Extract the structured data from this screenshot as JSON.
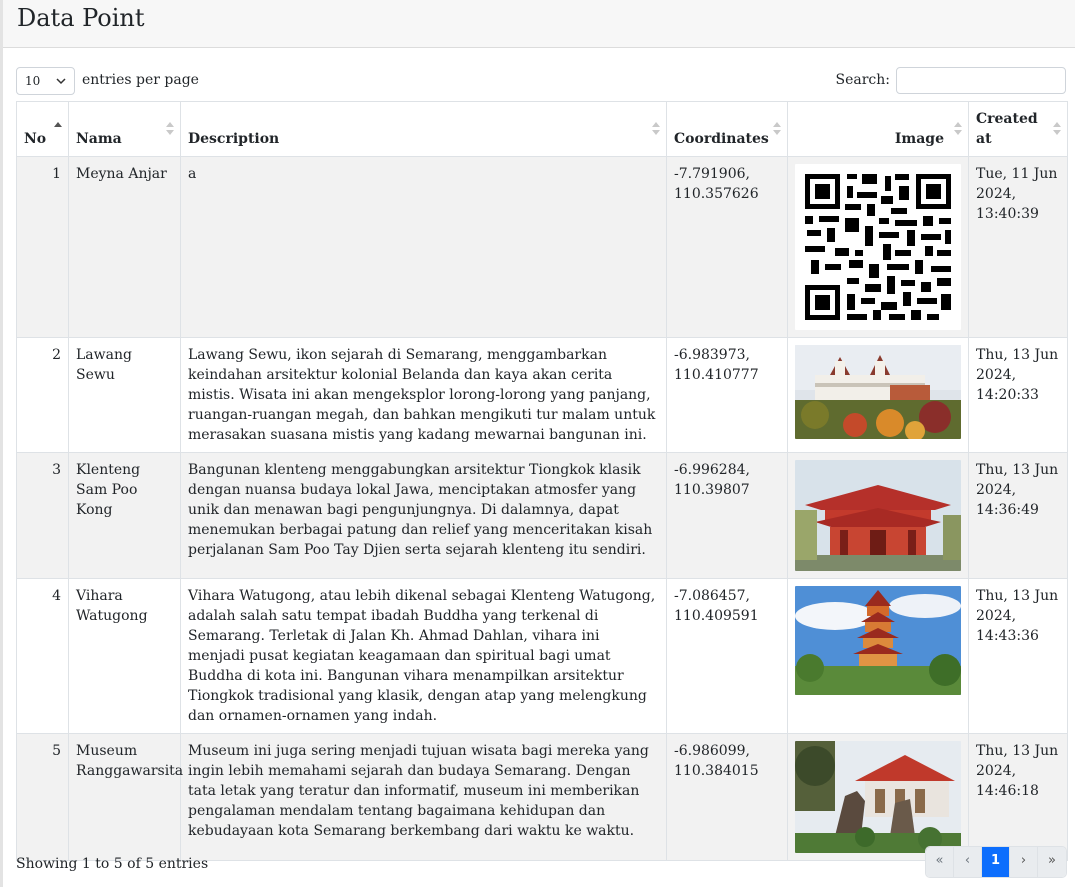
{
  "page": {
    "title": "Data Point"
  },
  "controls": {
    "length_value": "10",
    "length_label": "entries per page",
    "search_label": "Search:",
    "search_value": ""
  },
  "table": {
    "headers": [
      "No",
      "Nama",
      "Description",
      "Coordinates",
      "Image",
      "Created at"
    ],
    "rows": [
      {
        "no": "1",
        "nama": "Meyna Anjar",
        "description": "a",
        "coordinates": "-7.791906, 110.357626",
        "image": "qr-code",
        "created_at": "Tue, 11 Jun 2024, 13:40:39"
      },
      {
        "no": "2",
        "nama": "Lawang Sewu",
        "description": "Lawang Sewu, ikon sejarah di Semarang, menggambarkan keindahan arsitektur kolonial Belanda dan kaya akan cerita mistis. Wisata ini akan mengeksplor lorong-lorong yang panjang, ruangan-ruangan megah, dan bahkan mengikuti tur malam untuk merasakan suasana mistis yang kadang mewarnai bangunan ini.",
        "coordinates": "-6.983973, 110.410777",
        "image": "lawang-sewu-photo",
        "created_at": "Thu, 13 Jun 2024, 14:20:33"
      },
      {
        "no": "3",
        "nama": "Klenteng Sam Poo Kong",
        "description": "Bangunan klenteng menggabungkan arsitektur Tiongkok klasik dengan nuansa budaya lokal Jawa, menciptakan atmosfer yang unik dan menawan bagi pengunjungnya. Di dalamnya, dapat menemukan berbagai patung dan relief yang menceritakan kisah perjalanan Sam Poo Tay Djien serta sejarah klenteng itu sendiri.",
        "coordinates": "-6.996284, 110.39807",
        "image": "sam-poo-kong-photo",
        "created_at": "Thu, 13 Jun 2024, 14:36:49"
      },
      {
        "no": "4",
        "nama": "Vihara Watugong",
        "description": "Vihara Watugong, atau lebih dikenal sebagai Klenteng Watugong, adalah salah satu tempat ibadah Buddha yang terkenal di Semarang. Terletak di Jalan Kh. Ahmad Dahlan, vihara ini menjadi pusat kegiatan keagamaan dan spiritual bagi umat Buddha di kota ini. Bangunan vihara menampilkan arsitektur Tiongkok tradisional yang klasik, dengan atap yang melengkung dan ornamen-ornamen yang indah.",
        "coordinates": "-7.086457, 110.409591",
        "image": "vihara-watugong-photo",
        "created_at": "Thu, 13 Jun 2024, 14:43:36"
      },
      {
        "no": "5",
        "nama": "Museum Ranggawarsita",
        "description": "Museum ini juga sering menjadi tujuan wisata bagi mereka yang ingin lebih memahami sejarah dan budaya Semarang. Dengan tata letak yang teratur dan informatif, museum ini memberikan pengalaman mendalam tentang bagaimana kehidupan dan kebudayaan kota Semarang berkembang dari waktu ke waktu.",
        "coordinates": "-6.986099, 110.384015",
        "image": "museum-ranggawarsita-photo",
        "created_at": "Thu, 13 Jun 2024, 14:46:18"
      }
    ]
  },
  "footer": {
    "info": "Showing 1 to 5 of 5 entries",
    "pager": {
      "first": "«",
      "prev": "‹",
      "current": "1",
      "next": "›",
      "last": "»"
    }
  }
}
